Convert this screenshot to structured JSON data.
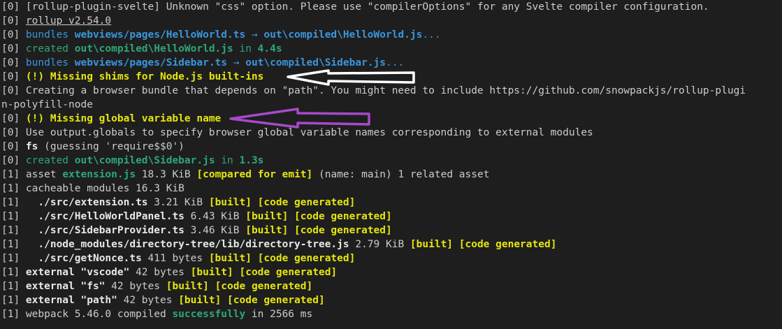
{
  "arrow_colors": {
    "white_arrow": "#ffffff",
    "purple_arrow": "#a64ac9"
  },
  "lines": [
    [
      {
        "t": "[0] [rollup-plugin-svelte] Unknown \"css\" option. Please use \"compilerOptions\" for any Svelte compiler configuration.",
        "s": "d"
      }
    ],
    [
      {
        "t": "[0] ",
        "s": "d"
      },
      {
        "t": "rollup v2.54.0",
        "s": "d u"
      }
    ],
    [
      {
        "t": "[0] ",
        "s": "d"
      },
      {
        "t": "bundles ",
        "s": "cy"
      },
      {
        "t": "webviews/pages/HelloWorld.ts",
        "s": "cyb"
      },
      {
        "t": " → ",
        "s": "cy"
      },
      {
        "t": "out\\compiled\\HelloWorld.js",
        "s": "cyb"
      },
      {
        "t": "...",
        "s": "cy"
      }
    ],
    [
      {
        "t": "[0] ",
        "s": "d"
      },
      {
        "t": "created ",
        "s": "gr"
      },
      {
        "t": "out\\compiled\\HelloWorld.js",
        "s": "grb"
      },
      {
        "t": " in ",
        "s": "gr"
      },
      {
        "t": "4.4s",
        "s": "grb"
      }
    ],
    [
      {
        "t": "[0] ",
        "s": "d"
      },
      {
        "t": "bundles ",
        "s": "cy"
      },
      {
        "t": "webviews/pages/Sidebar.ts",
        "s": "cyb"
      },
      {
        "t": " → ",
        "s": "cy"
      },
      {
        "t": "out\\compiled\\Sidebar.js",
        "s": "cyb"
      },
      {
        "t": "...",
        "s": "cy"
      }
    ],
    [
      {
        "t": "[0] ",
        "s": "d"
      },
      {
        "t": "(!) Missing shims for Node.js built-ins",
        "s": "yb"
      }
    ],
    [
      {
        "t": "[0] Creating a browser bundle that depends on \"path\". You might need to include https://github.com/snowpackjs/rollup-plugi",
        "s": "d"
      }
    ],
    [
      {
        "t": "n-polyfill-node",
        "s": "d"
      }
    ],
    [
      {
        "t": "[0] ",
        "s": "d"
      },
      {
        "t": "(!) Missing global variable name",
        "s": "yb"
      }
    ],
    [
      {
        "t": "[0] Use output.globals to specify browser global variable names corresponding to external modules",
        "s": "d"
      }
    ],
    [
      {
        "t": "[0] ",
        "s": "d"
      },
      {
        "t": "fs",
        "s": "b"
      },
      {
        "t": " (guessing 'require$$0')",
        "s": "d"
      }
    ],
    [
      {
        "t": "[0] ",
        "s": "d"
      },
      {
        "t": "created ",
        "s": "gr"
      },
      {
        "t": "out\\compiled\\Sidebar.js",
        "s": "grb"
      },
      {
        "t": " in ",
        "s": "gr"
      },
      {
        "t": "1.3s",
        "s": "grb"
      }
    ],
    [
      {
        "t": "[1] asset ",
        "s": "d"
      },
      {
        "t": "extension.js",
        "s": "grb"
      },
      {
        "t": " 18.3 KiB ",
        "s": "d"
      },
      {
        "t": "[compared for emit]",
        "s": "yb"
      },
      {
        "t": " (name: main) 1 related asset",
        "s": "d"
      }
    ],
    [
      {
        "t": "[1] cacheable modules 16.3 KiB",
        "s": "d"
      }
    ],
    [
      {
        "t": "[1]   ",
        "s": "d"
      },
      {
        "t": "./src/extension.ts",
        "s": "b"
      },
      {
        "t": " 3.21 KiB ",
        "s": "d"
      },
      {
        "t": "[built] [code generated]",
        "s": "yb"
      }
    ],
    [
      {
        "t": "[1]   ",
        "s": "d"
      },
      {
        "t": "./src/HelloWorldPanel.ts",
        "s": "b"
      },
      {
        "t": " 6.43 KiB ",
        "s": "d"
      },
      {
        "t": "[built] [code generated]",
        "s": "yb"
      }
    ],
    [
      {
        "t": "[1]   ",
        "s": "d"
      },
      {
        "t": "./src/SidebarProvider.ts",
        "s": "b"
      },
      {
        "t": " 3.46 KiB ",
        "s": "d"
      },
      {
        "t": "[built] [code generated]",
        "s": "yb"
      }
    ],
    [
      {
        "t": "[1]   ",
        "s": "d"
      },
      {
        "t": "./node_modules/directory-tree/lib/directory-tree.js",
        "s": "b"
      },
      {
        "t": " 2.79 KiB ",
        "s": "d"
      },
      {
        "t": "[built] [code generated]",
        "s": "yb"
      }
    ],
    [
      {
        "t": "[1]   ",
        "s": "d"
      },
      {
        "t": "./src/getNonce.ts",
        "s": "b"
      },
      {
        "t": " 411 bytes ",
        "s": "d"
      },
      {
        "t": "[built] [code generated]",
        "s": "yb"
      }
    ],
    [
      {
        "t": "[1] ",
        "s": "d"
      },
      {
        "t": "external \"vscode\"",
        "s": "b"
      },
      {
        "t": " 42 bytes ",
        "s": "d"
      },
      {
        "t": "[built] [code generated]",
        "s": "yb"
      }
    ],
    [
      {
        "t": "[1] ",
        "s": "d"
      },
      {
        "t": "external \"fs\"",
        "s": "b"
      },
      {
        "t": " 42 bytes ",
        "s": "d"
      },
      {
        "t": "[built] [code generated]",
        "s": "yb"
      }
    ],
    [
      {
        "t": "[1] ",
        "s": "d"
      },
      {
        "t": "external \"path\"",
        "s": "b"
      },
      {
        "t": " 42 bytes ",
        "s": "d"
      },
      {
        "t": "[built] [code generated]",
        "s": "yb"
      }
    ],
    [
      {
        "t": "[1] webpack 5.46.0 compiled ",
        "s": "d"
      },
      {
        "t": "successfully",
        "s": "grb"
      },
      {
        "t": " in 2566 ms",
        "s": "d"
      }
    ]
  ]
}
